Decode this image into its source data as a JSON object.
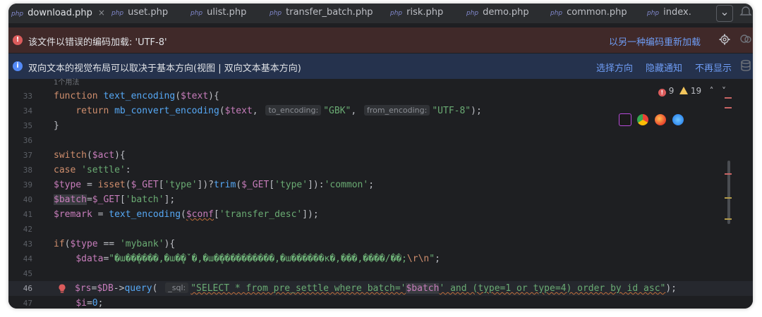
{
  "tabs": [
    {
      "prefix": "php",
      "label": "download.php",
      "active": true,
      "close": "×"
    },
    {
      "prefix": "php",
      "label": "uset.php"
    },
    {
      "prefix": "php",
      "label": "ulist.php"
    },
    {
      "prefix": "php",
      "label": "transfer_batch.php"
    },
    {
      "prefix": "php",
      "label": "risk.php"
    },
    {
      "prefix": "php",
      "label": "demo.php"
    },
    {
      "prefix": "php",
      "label": "common.php"
    },
    {
      "prefix": "php",
      "label": "index."
    }
  ],
  "tab_overflow": "⌄",
  "error_banner": {
    "icon": "!",
    "text": "该文件以错误的编码加载: 'UTF-8'",
    "action": "以另一种编码重新加载",
    "gear": "gear-icon"
  },
  "info_banner": {
    "icon": "i",
    "text": "双向文本的视觉布局可以取决于基本方向(视图 | 双向文本基本方向)",
    "actions": [
      "选择方向",
      "隐藏通知",
      "不再显示"
    ]
  },
  "problems": {
    "errors": "9",
    "warnings": "19",
    "up": "˄",
    "down": "˅"
  },
  "usage_hint": "1个用法",
  "lines": {
    "ln33": "33",
    "ln34": "34",
    "ln35": "35",
    "ln36": "36",
    "ln37": "37",
    "ln38": "38",
    "ln39": "39",
    "ln40": "40",
    "ln41": "41",
    "ln42": "42",
    "ln43": "43",
    "ln44": "44",
    "ln45": "45",
    "ln46": "46",
    "ln47": "47"
  },
  "code": {
    "l33_kw": "function",
    "l33_fn": "text_encoding",
    "l33_p1": "(",
    "l33_var": "$text",
    "l33_p2": "){",
    "l34_kw": "return",
    "l34_fn": "mb_convert_encoding",
    "l34_p1": "(",
    "l34_var": "$text",
    "l34_c1": ",",
    "l34_h1": "to_encoding:",
    "l34_s1": "\"GBK\"",
    "l34_c2": ",",
    "l34_h2": "from_encoding:",
    "l34_s2": "\"UTF-8\"",
    "l34_end": ");",
    "l35": "}",
    "l37_kw": "switch",
    "l37_p1": "(",
    "l37_var": "$act",
    "l37_p2": "){",
    "l38_kw": "case",
    "l38_s": "'settle'",
    "l38_c": ":",
    "l39_var": "$type",
    "l39_eq": " = ",
    "l39_fn1": "isset",
    "l39_p1": "(",
    "l39_var2": "$_GET",
    "l39_b1": "[",
    "l39_s1": "'type'",
    "l39_b2": "])?",
    "l39_fn2": "trim",
    "l39_p2": "(",
    "l39_var3": "$_GET",
    "l39_b3": "[",
    "l39_s2": "'type'",
    "l39_b4": "]):",
    "l39_s3": "'common'",
    "l39_end": ";",
    "l40_var": "$batch",
    "l40_eq": "=",
    "l40_var2": "$_GET",
    "l40_b1": "[",
    "l40_s": "'batch'",
    "l40_end": "];",
    "l41_var": "$remark",
    "l41_eq": " = ",
    "l41_fn": "text_encoding",
    "l41_p1": "(",
    "l41_var2": "$conf",
    "l41_b1": "[",
    "l41_s": "'transfer_desc'",
    "l41_end": "]);",
    "l43_kw": "if",
    "l43_p1": "(",
    "l43_var": "$type",
    "l43_op": " == ",
    "l43_s": "'mybank'",
    "l43_end": "){",
    "l44_var": "$data",
    "l44_eq": "=",
    "l44_s": "\"�ա��ܷ����,�ա�ܷ�ˇ�,�ա�ܷ����������,�ա������к�,���,����/��;",
    "l44_esc": "\\r\\n",
    "l44_s2": "\"",
    "l44_end": ";",
    "l46_var": "$rs",
    "l46_eq": "=",
    "l46_var2": "$DB",
    "l46_arrow": "->",
    "l46_fn": "query",
    "l46_p1": "(",
    "l46_h": "_sql:",
    "l46_s1": "\"SELECT * from pre_settle where batch='",
    "l46_var3": "$batch",
    "l46_s2": "' and (type=1 or type=4) order by id asc\"",
    "l46_end": ");",
    "l47_var": "$i",
    "l47_eq": "=",
    "l47_num": "0",
    "l47_end": ";"
  },
  "colors": {
    "error": "#db5c5c",
    "warning": "#f2c55c",
    "link": "#6e9cf4"
  },
  "browser_icons": [
    "phpstorm-icon",
    "chrome-icon",
    "firefox-icon",
    "safari-icon"
  ]
}
